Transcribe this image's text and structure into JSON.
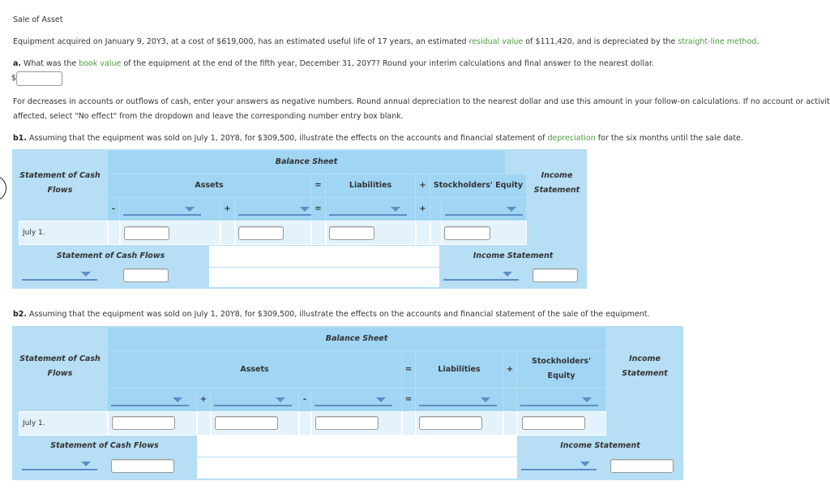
{
  "title": "Sale of Asset",
  "intro": {
    "p1": "Equipment acquired on January 9, 20Y3, at a cost of $619,000, has an estimated useful life of 17 years, an estimated ",
    "link1": "residual value",
    "p2": " of $111,420, and is depreciated by the ",
    "link2": "straight-line method",
    "p3": "."
  },
  "question_a": {
    "label": "a.",
    "p1": " What was the ",
    "link": "book value",
    "p2": " of the equipment at the end of the fifth year, December 31, 20Y7? Round your interim calculations and final answer to the nearest dollar.",
    "currency": "$",
    "answer": ""
  },
  "instructions": {
    "line1": "For decreases in accounts or outflows of cash, enter your answers as negative numbers. Round annual depreciation to the nearest dollar and use this amount in your follow-on calculations. If no account or activity is",
    "line2": "affected, select \"No effect\" from the dropdown and leave the corresponding number entry box blank."
  },
  "question_b1": {
    "label": "b1.",
    "p1": " Assuming that the equipment was sold on July 1, 20Y8, for $309,500, illustrate the effects on the accounts and financial statement of ",
    "link": "depreciation",
    "p2": " for the six months until the sale date."
  },
  "question_b2": {
    "label": "b2.",
    "text": " Assuming that the equipment was sold on July 1, 20Y8, for $309,500, illustrate the effects on the accounts and financial statement of the sale of the equipment."
  },
  "table1": {
    "balance_sheet": "Balance Sheet",
    "scf_header": "Statement of Cash Flows",
    "assets": "Assets",
    "eq": "=",
    "liabilities": "Liabilities",
    "plus": "+",
    "minus": "-",
    "equity": "Stockholders' Equity",
    "income_statement": "Income Statement",
    "row_label": "July 1.",
    "scf_footer": "Statement of Cash Flows",
    "is_footer": "Income Statement",
    "selects": [
      "",
      "",
      "",
      "",
      ""
    ],
    "inputs": [
      "",
      "",
      "",
      "",
      ""
    ]
  },
  "table2": {
    "balance_sheet": "Balance Sheet",
    "scf_header": "Statement of Cash Flows",
    "assets": "Assets",
    "eq": "=",
    "liabilities": "Liabilities",
    "plus": "+",
    "minus": "-",
    "equity_line1": "Stockholders'",
    "equity_line2": "Equity",
    "income_statement": "Income Statement",
    "row_label": "July 1.",
    "scf_footer": "Statement of Cash Flows",
    "is_footer": "Income Statement",
    "selects": [
      "",
      "",
      "",
      "",
      "",
      "",
      ""
    ],
    "inputs": [
      "",
      "",
      "",
      "",
      "",
      "",
      ""
    ]
  }
}
